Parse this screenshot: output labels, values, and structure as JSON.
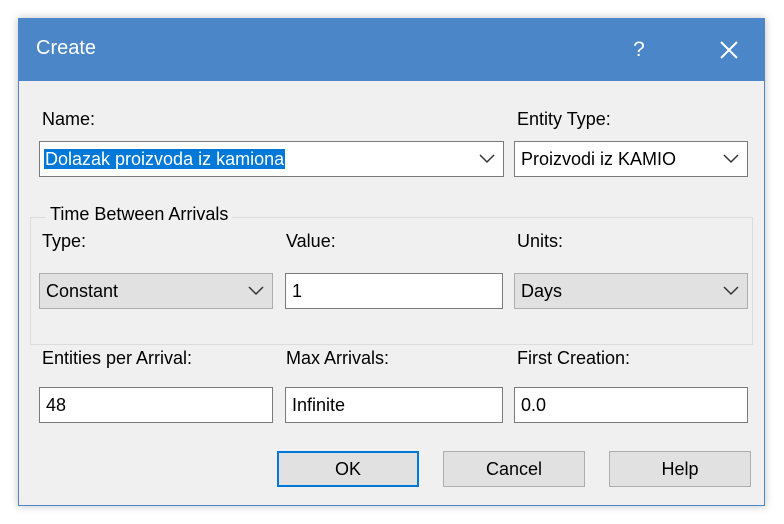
{
  "window": {
    "title": "Create",
    "help_glyph": "?",
    "close_icon": "close-icon"
  },
  "name": {
    "label": "Name:",
    "value": "Dolazak proizvoda iz kamiona"
  },
  "entity_type": {
    "label": "Entity Type:",
    "value": "Proizvodi iz KAMIO"
  },
  "time_between_arrivals": {
    "group_label": "Time Between Arrivals",
    "type_label": "Type:",
    "type_value": "Constant",
    "value_label": "Value:",
    "value_value": "1",
    "units_label": "Units:",
    "units_value": "Days"
  },
  "entities_per_arrival": {
    "label": "Entities per Arrival:",
    "value": "48"
  },
  "max_arrivals": {
    "label": "Max Arrivals:",
    "value": "Infinite"
  },
  "first_creation": {
    "label": "First Creation:",
    "value": "0.0"
  },
  "buttons": {
    "ok": "OK",
    "cancel": "Cancel",
    "help": "Help"
  },
  "colors": {
    "titlebar": "#4a86c8",
    "selection": "#0078d7",
    "dialog_bg": "#f0f0f0"
  }
}
